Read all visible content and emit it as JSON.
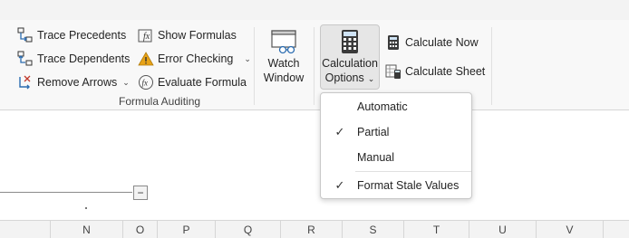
{
  "ribbon": {
    "formula_auditing": {
      "trace_precedents": "Trace Precedents",
      "trace_dependents": "Trace Dependents",
      "remove_arrows": "Remove Arrows",
      "show_formulas": "Show Formulas",
      "error_checking": "Error Checking",
      "evaluate_formula": "Evaluate Formula",
      "group_label": "Formula Auditing"
    },
    "watch_window": {
      "line1": "Watch",
      "line2": "Window"
    },
    "calculation": {
      "options_line1": "Calculation",
      "options_line2": "Options",
      "calculate_now": "Calculate Now",
      "calculate_sheet": "Calculate Sheet"
    }
  },
  "calc_menu": {
    "items": [
      {
        "label": "Automatic",
        "checked": false
      },
      {
        "label": "Partial",
        "checked": true
      },
      {
        "label": "Manual",
        "checked": false
      },
      {
        "label": "Format Stale Values",
        "checked": true
      }
    ]
  },
  "collapse_symbol": "−",
  "check_glyph": "✓",
  "columns": [
    "N",
    "O",
    "P",
    "Q",
    "R",
    "S",
    "T",
    "U",
    "V"
  ],
  "colors": {
    "icon_blue": "#2b6cb0",
    "warning_amber": "#e8a317",
    "menu_border": "#c8c8c8"
  }
}
